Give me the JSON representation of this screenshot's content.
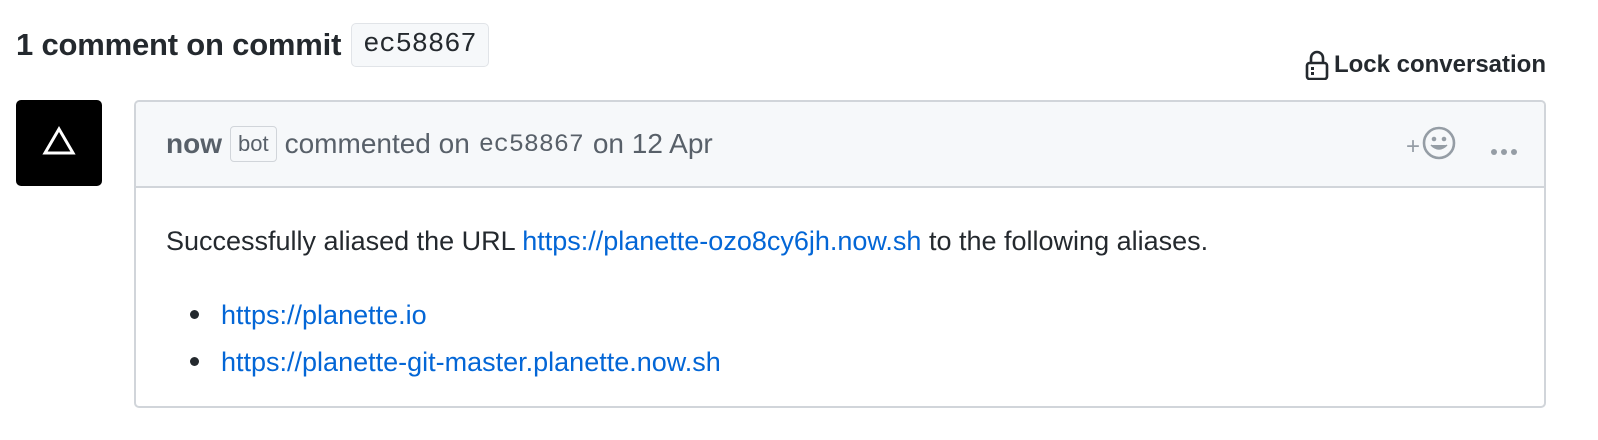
{
  "heading": {
    "title": "1 comment on commit",
    "sha": "ec58867"
  },
  "lock": {
    "label": "Lock conversation",
    "icon": "lock-icon"
  },
  "avatar": {
    "icon": "triangle-logo-icon"
  },
  "comment": {
    "author": "now",
    "badge": "bot",
    "action": "commented on",
    "sha": "ec58867",
    "date": "on 12 Apr",
    "reaction_plus": "+",
    "reaction_icon": "smiley-icon",
    "more_icon": "kebab-horizontal-icon",
    "body": {
      "prefix": "Successfully aliased the URL",
      "url": "https://planette-ozo8cy6jh.now.sh",
      "suffix": "to the following aliases.",
      "aliases": [
        "https://planette.io",
        "https://planette-git-master.planette.now.sh"
      ]
    }
  },
  "colors": {
    "link": "#0366d6",
    "text": "#24292e",
    "muted": "#586069",
    "border": "#d1d5da",
    "header_bg": "#f6f8fa",
    "avatar_bg": "#000000"
  }
}
